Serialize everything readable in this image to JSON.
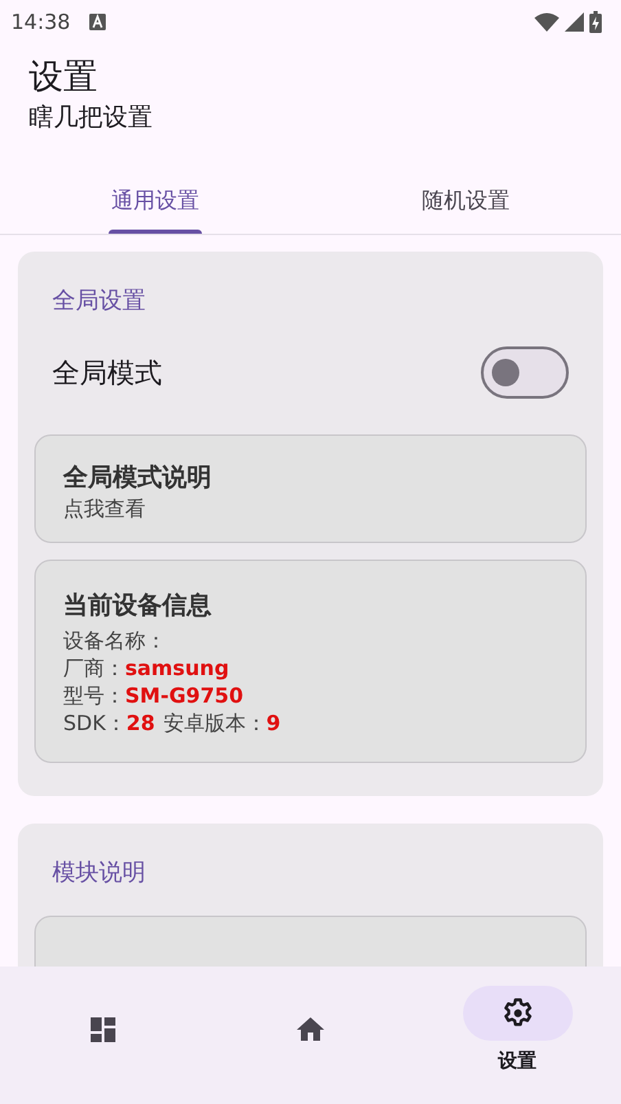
{
  "status_bar": {
    "time": "14:38"
  },
  "header": {
    "title": "设置",
    "subtitle": "瞎几把设置"
  },
  "tabs": [
    {
      "label": "通用设置",
      "selected": true
    },
    {
      "label": "随机设置",
      "selected": false
    }
  ],
  "global_section": {
    "heading": "全局设置",
    "toggle": {
      "label": "全局模式",
      "on": false
    },
    "help_card": {
      "title": "全局模式说明",
      "subtitle": "点我查看"
    },
    "device_card": {
      "title": "当前设备信息",
      "rows": [
        [
          {
            "label": "设备名称："
          }
        ],
        [
          {
            "label": "厂商：",
            "value": "samsung"
          }
        ],
        [
          {
            "label": "型号：",
            "value": "SM-G9750"
          }
        ],
        [
          {
            "label": "SDK：",
            "value": "28"
          },
          {
            "label": "安卓版本：",
            "value": "9"
          }
        ]
      ]
    }
  },
  "module_section": {
    "heading": "模块说明"
  },
  "bottom_nav": [
    {
      "kind": "dashboard",
      "selected": false
    },
    {
      "kind": "home",
      "selected": false
    },
    {
      "kind": "settings",
      "label": "设置",
      "selected": true
    }
  ]
}
